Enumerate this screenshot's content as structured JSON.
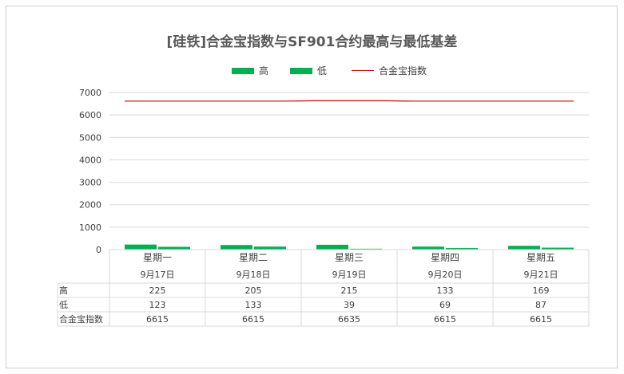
{
  "chart_data": {
    "type": "bar",
    "title": "[硅铁]合金宝指数与SF901合约最高与最低基差",
    "categories": [
      "星期一",
      "星期二",
      "星期三",
      "星期四",
      "星期五"
    ],
    "dates": [
      "9月17日",
      "9月18日",
      "9月19日",
      "9月20日",
      "9月21日"
    ],
    "series": [
      {
        "name": "高",
        "type": "bar",
        "color": "#00b050",
        "values": [
          225,
          205,
          215,
          133,
          169
        ]
      },
      {
        "name": "低",
        "type": "bar",
        "color": "#00b050",
        "values": [
          123,
          133,
          39,
          69,
          87
        ]
      },
      {
        "name": "合金宝指数",
        "type": "line",
        "color": "#c00000",
        "values": [
          6615,
          6615,
          6635,
          6615,
          6615
        ]
      }
    ],
    "ylim": [
      0,
      7000
    ],
    "yticks": [
      "0",
      "1000",
      "2000",
      "3000",
      "4000",
      "5000",
      "6000",
      "7000"
    ],
    "grid": true,
    "legend_position": "top",
    "data_table": true
  }
}
